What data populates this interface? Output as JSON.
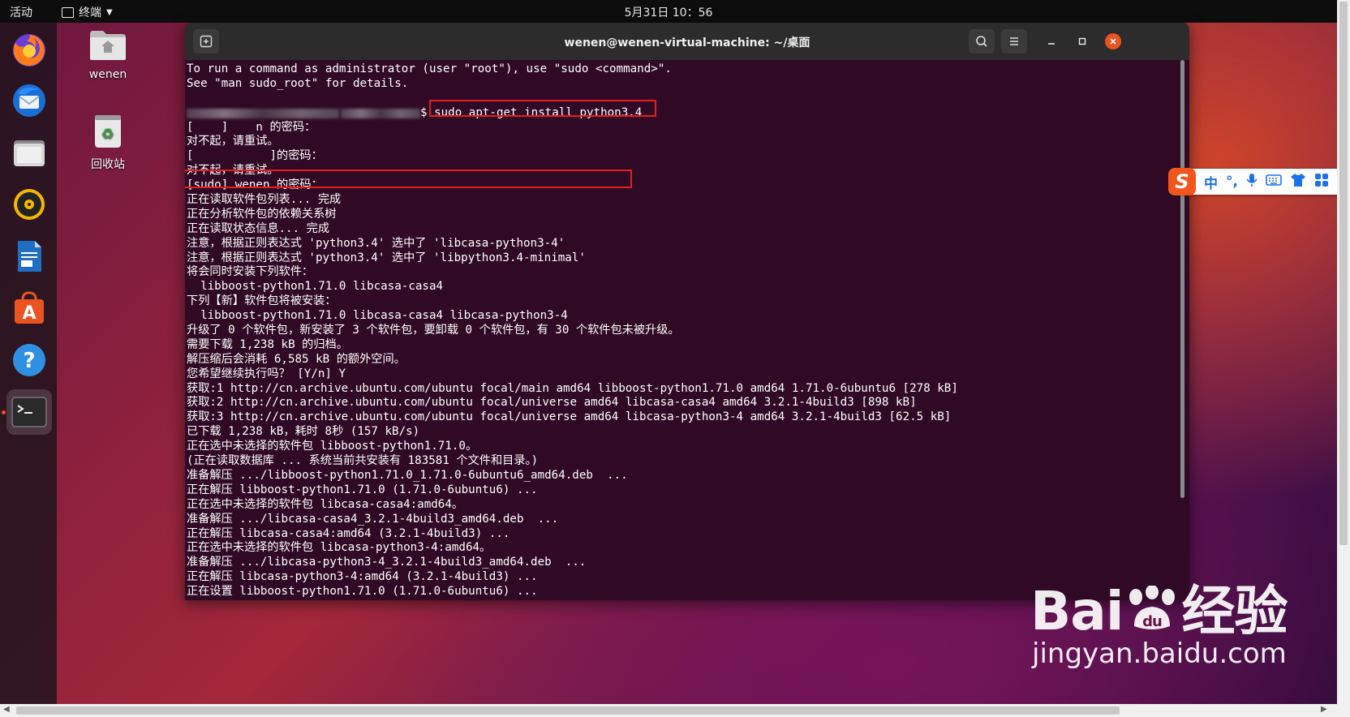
{
  "topbar": {
    "activities": "活动",
    "app_menu": "终端",
    "clock": "5月31日 10：56"
  },
  "desktop": {
    "icons": [
      {
        "label": "wenen",
        "icon": "home-folder-icon"
      },
      {
        "label": "回收站",
        "icon": "trash-icon"
      }
    ]
  },
  "dock": {
    "items": [
      {
        "name": "firefox",
        "icon": "firefox-icon"
      },
      {
        "name": "thunderbird",
        "icon": "thunderbird-icon"
      },
      {
        "name": "files",
        "icon": "files-icon"
      },
      {
        "name": "rhythmbox",
        "icon": "rhythmbox-icon"
      },
      {
        "name": "libreoffice-writer",
        "icon": "writer-icon"
      },
      {
        "name": "ubuntu-software",
        "icon": "software-icon"
      },
      {
        "name": "help",
        "icon": "help-icon"
      },
      {
        "name": "terminal",
        "icon": "terminal-icon"
      }
    ],
    "accent": "#e95420"
  },
  "terminal": {
    "title": "wenen@wenen-virtual-machine: ~/桌面",
    "background": "#300a24",
    "lines": [
      "To run a command as administrator (user \"root\"), use \"sudo <command>\".",
      "See \"man sudo_root\" for details.",
      "",
      "__PROMPT__",
      "[    ]    n 的密码：",
      "对不起，请重试。",
      "[           ]的密码：",
      "对不起，请重试。",
      "[sudo] wenen 的密码：",
      "正在读取软件包列表... 完成",
      "正在分析软件包的依赖关系树",
      "正在读取状态信息... 完成",
      "注意，根据正则表达式 'python3.4' 选中了 'libcasa-python3-4'",
      "注意，根据正则表达式 'python3.4' 选中了 'libpython3.4-minimal'",
      "将会同时安装下列软件：",
      "  libboost-python1.71.0 libcasa-casa4",
      "下列【新】软件包将被安装：",
      "  libboost-python1.71.0 libcasa-casa4 libcasa-python3-4",
      "升级了 0 个软件包，新安装了 3 个软件包，要卸载 0 个软件包，有 30 个软件包未被升级。",
      "需要下载 1,238 kB 的归档。",
      "解压缩后会消耗 6,585 kB 的额外空间。",
      "您希望继续执行吗？ [Y/n] Y",
      "获取:1 http://cn.archive.ubuntu.com/ubuntu focal/main amd64 libboost-python1.71.0 amd64 1.71.0-6ubuntu6 [278 kB]",
      "获取:2 http://cn.archive.ubuntu.com/ubuntu focal/universe amd64 libcasa-casa4 amd64 3.2.1-4build3 [898 kB]",
      "获取:3 http://cn.archive.ubuntu.com/ubuntu focal/universe amd64 libcasa-python3-4 amd64 3.2.1-4build3 [62.5 kB]",
      "已下载 1,238 kB，耗时 8秒 (157 kB/s)",
      "正在选中未选择的软件包 libboost-python1.71.0。",
      "(正在读取数据库 ... 系统当前共安装有 183581 个文件和目录。)",
      "准备解压 .../libboost-python1.71.0_1.71.0-6ubuntu6_amd64.deb  ...",
      "正在解压 libboost-python1.71.0 (1.71.0-6ubuntu6) ...",
      "正在选中未选择的软件包 libcasa-casa4:amd64。",
      "准备解压 .../libcasa-casa4_3.2.1-4build3_amd64.deb  ...",
      "正在解压 libcasa-casa4:amd64 (3.2.1-4build3) ...",
      "正在选中未选择的软件包 libcasa-python3-4:amd64。",
      "准备解压 .../libcasa-python3-4_3.2.1-4build3_amd64.deb  ...",
      "正在解压 libcasa-python3-4:amd64 (3.2.1-4build3) ...",
      "正在设置 libboost-python1.71.0 (1.71.0-6ubuntu6) ..."
    ],
    "prompt_suffix": "$",
    "command": " sudo apt-get install python3.4"
  },
  "ime": {
    "logo": "S",
    "items": [
      "中",
      "°,",
      "mic-icon",
      "keyboard-icon",
      "shirt-icon",
      "grid-icon"
    ]
  },
  "watermark": {
    "brand": "Bai",
    "brand_suffix": "经验",
    "url": "jingyan.baidu.com"
  }
}
